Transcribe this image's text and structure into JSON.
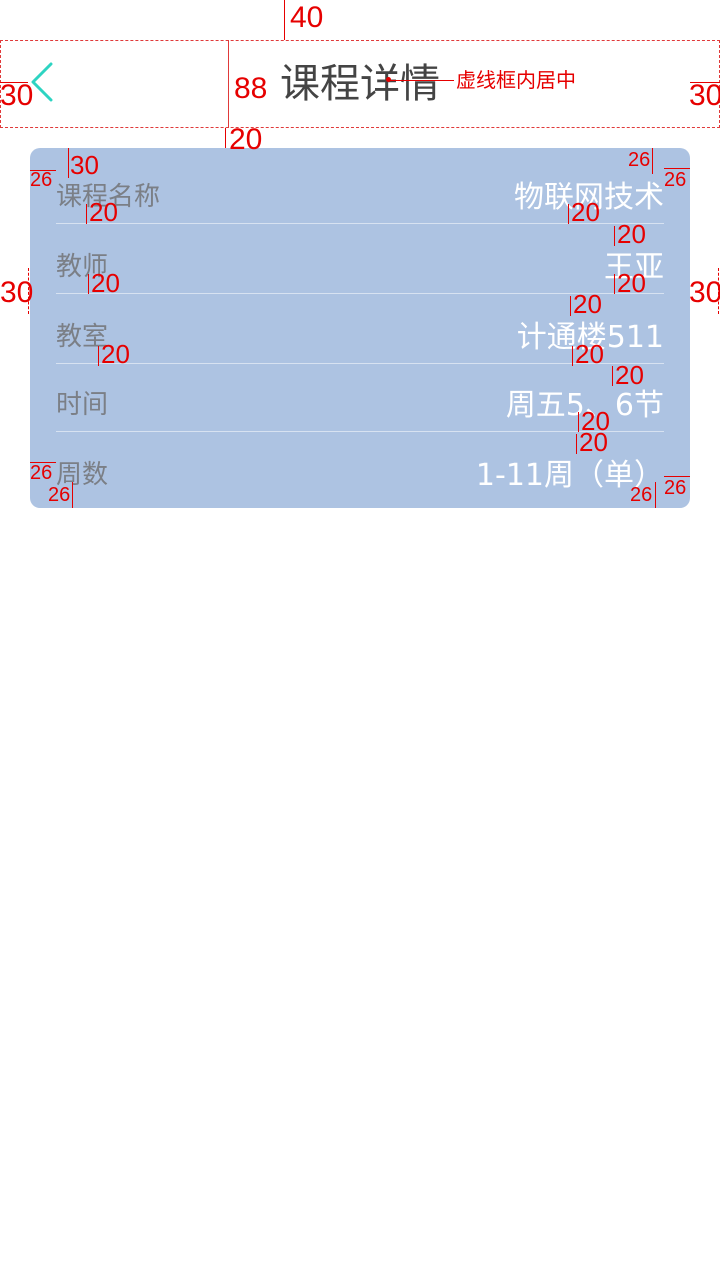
{
  "header": {
    "title": "课程详情",
    "back_icon": "chevron-left-icon",
    "accent_color": "#2dd4c2"
  },
  "card": {
    "background": "#adc3e2",
    "rows": [
      {
        "label": "课程名称",
        "value": "物联网技术"
      },
      {
        "label": "教师",
        "value": "王亚"
      },
      {
        "label": "教室",
        "value": "计通楼511"
      },
      {
        "label": "时间",
        "value": "周五5、6节"
      },
      {
        "label": "周数",
        "value": "1-11周（单）"
      }
    ]
  },
  "annotations": {
    "top_margin": "40",
    "header_height": "88",
    "header_left": "30",
    "header_right": "30",
    "header_note": "虚线框内居中",
    "header_gap": "20",
    "card_left": "30",
    "card_right": "30",
    "pad_top": "30",
    "pad_left": "26",
    "pad_right": "26",
    "pad_bottom_left": "26",
    "pad_bottom_right": "26",
    "pad_top_right": "26",
    "spacing": [
      "20",
      "20",
      "20",
      "20",
      "20",
      "20",
      "20",
      "20",
      "20",
      "20",
      "20",
      "20"
    ]
  }
}
